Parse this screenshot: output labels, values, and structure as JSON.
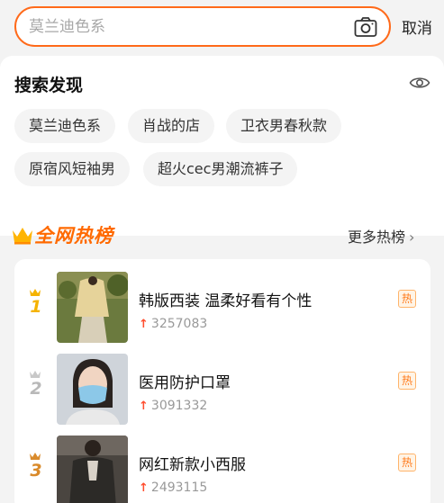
{
  "search": {
    "placeholder": "莫兰迪色系",
    "cancel_label": "取消"
  },
  "discover": {
    "title": "搜索发现",
    "chips": [
      "莫兰迪色系",
      "肖战的店",
      "卫衣男春秋款",
      "原宿风短袖男",
      "超火cec男潮流裤子"
    ]
  },
  "hot": {
    "title": "全网热榜",
    "more_label": "更多热榜",
    "badge_label": "热",
    "items": [
      {
        "rank": "1",
        "title": "韩版西装 温柔好看有个性",
        "count": "3257083"
      },
      {
        "rank": "2",
        "title": "医用防护口罩",
        "count": "3091332"
      },
      {
        "rank": "3",
        "title": "网红新款小西服",
        "count": "2493115"
      }
    ]
  },
  "colors": {
    "accent": "#ff6a1a",
    "rank1": "#f5b300",
    "rank2": "#b9b9b9",
    "rank3": "#d98a2b",
    "hot_arrow": "#ff4d2e"
  },
  "icons": [
    "camera-icon",
    "eye-icon",
    "crown-icon",
    "chevron-right-icon",
    "up-arrow-icon"
  ]
}
